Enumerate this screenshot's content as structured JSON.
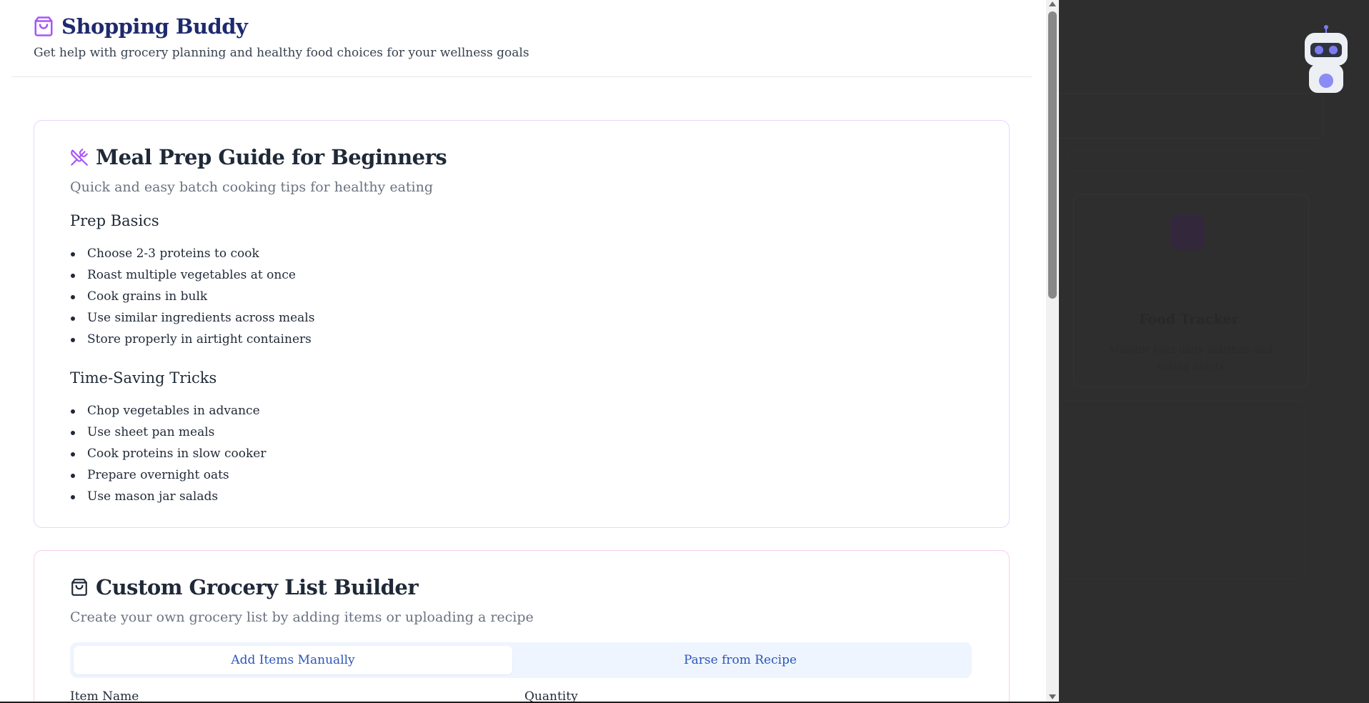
{
  "app": {
    "title": "Shopping Buddy",
    "subtitle": "Get help with grocery planning and healthy food choices for your wellness goals",
    "accent_color": "#a855f7",
    "title_color": "#1e2a6e"
  },
  "meal_prep": {
    "icon": "utensils-crossed-icon",
    "title": "Meal Prep Guide for Beginners",
    "subtitle": "Quick and easy batch cooking tips for healthy eating",
    "sections": [
      {
        "title": "Prep Basics",
        "items": [
          "Choose 2-3 proteins to cook",
          "Roast multiple vegetables at once",
          "Cook grains in bulk",
          "Use similar ingredients across meals",
          "Store properly in airtight containers"
        ]
      },
      {
        "title": "Time-Saving Tricks",
        "items": [
          "Chop vegetables in advance",
          "Use sheet pan meals",
          "Cook proteins in slow cooker",
          "Prepare overnight oats",
          "Use mason jar salads"
        ]
      }
    ]
  },
  "grocery_builder": {
    "icon": "shopping-bag-icon",
    "title": "Custom Grocery List Builder",
    "subtitle": "Create your own grocery list by adding items or uploading a recipe",
    "tabs": [
      {
        "label": "Add Items Manually",
        "active": true
      },
      {
        "label": "Parse from Recipe",
        "active": false
      }
    ],
    "fields": {
      "item_name_label": "Item Name",
      "quantity_label": "Quantity"
    }
  },
  "overlay": {
    "ghost_title": "Food Tracker",
    "ghost_text_1": "Monitor your daily nutrition and",
    "ghost_text_2": "eating habits",
    "assistant_icon": "robot-assistant-icon"
  }
}
